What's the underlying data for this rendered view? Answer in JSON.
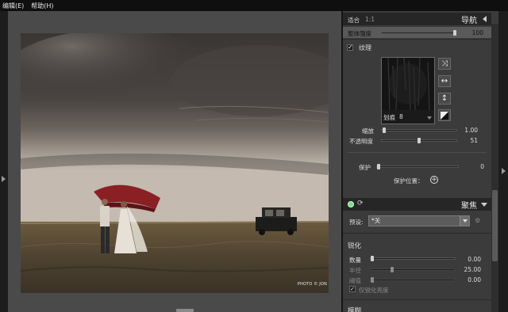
{
  "menu": {
    "items": [
      "编辑(E)",
      "帮助(H)"
    ]
  },
  "photo": {
    "credit": "PHOTO © JON"
  },
  "navigator": {
    "fit_label": "适合",
    "ratio_label": "1:1",
    "title": "导航"
  },
  "overall": {
    "label": "整体强度",
    "value": "100",
    "fraction": 0.95
  },
  "texture": {
    "label": "纹理",
    "checked": true,
    "preset_label": "划痕",
    "preset_number": "8",
    "scale": {
      "label": "缩放",
      "value": "1.00",
      "fraction": 0.03
    },
    "opacity": {
      "label": "不透明度",
      "value": "51",
      "fraction": 0.51
    },
    "protect": {
      "label": "保护",
      "value": "0",
      "fraction": 0.0
    },
    "protect_position_label": "保护位置："
  },
  "focus": {
    "title": "聚焦",
    "preset_label": "预设:",
    "preset_value": "*关"
  },
  "sharpen": {
    "title": "锐化",
    "amount": {
      "label": "数量",
      "value": "0.00",
      "fraction": 0.0
    },
    "radius": {
      "label": "半径",
      "value": "25.00",
      "fraction": 0.25
    },
    "threshold": {
      "label": "阈值",
      "value": "0.00",
      "fraction": 0.0
    },
    "luminance_only_label": "仅锐化亮度",
    "luminance_only_checked": true
  },
  "blur": {
    "title": "模糊"
  },
  "colors": {
    "panel_bg": "#3b3b3b",
    "header_bg": "#262626",
    "menubar_bg": "#0f0f0f"
  }
}
